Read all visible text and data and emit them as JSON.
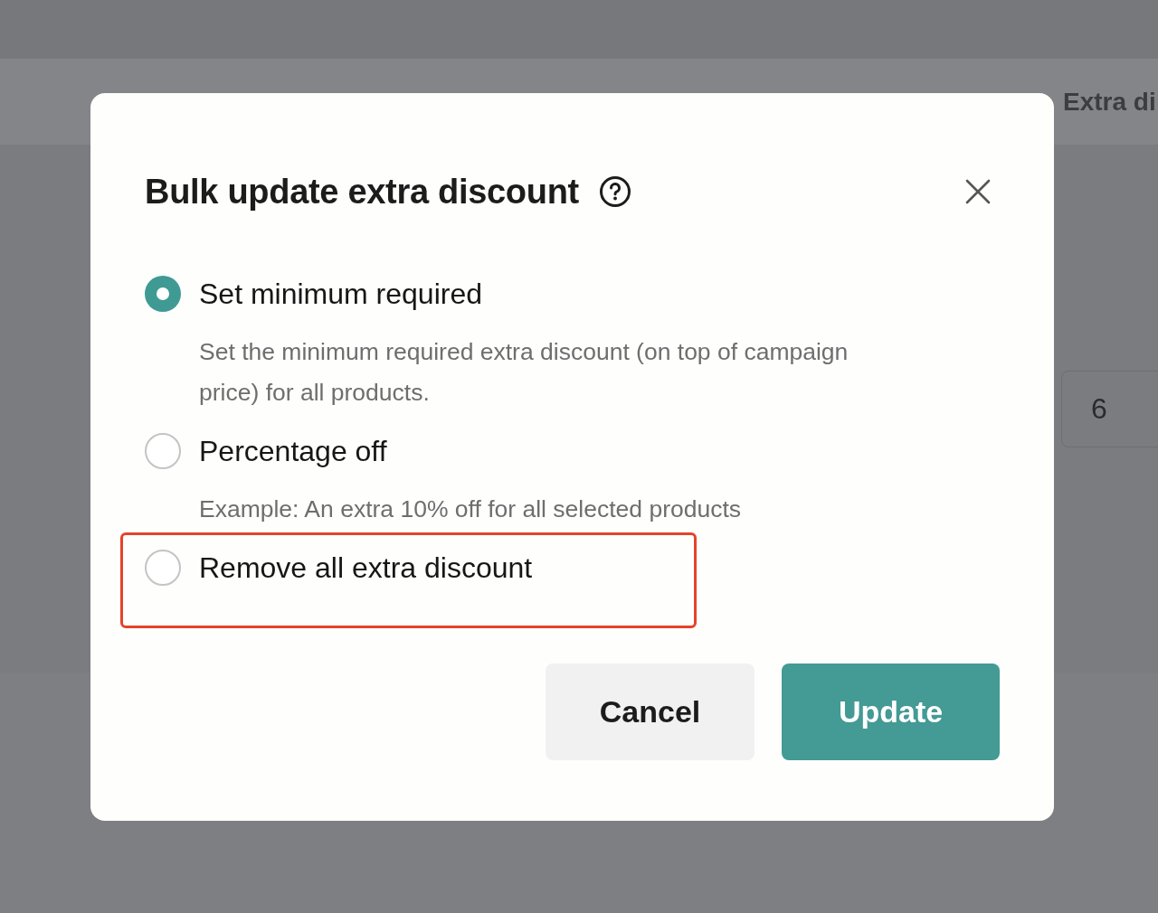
{
  "background": {
    "column_heading": "Extra di",
    "field_value": "6"
  },
  "dialog": {
    "title": "Bulk update extra discount",
    "options": [
      {
        "label": "Set minimum required",
        "description": "Set the minimum required extra discount (on top of campaign price) for all products.",
        "selected": true,
        "highlighted": false
      },
      {
        "label": "Percentage off",
        "description": "Example: An extra 10% off for all selected products",
        "selected": false,
        "highlighted": false
      },
      {
        "label": "Remove all extra discount",
        "selected": false,
        "highlighted": true
      }
    ],
    "buttons": [
      {
        "label": "Cancel",
        "kind": "secondary"
      },
      {
        "label": "Update",
        "kind": "primary"
      }
    ]
  }
}
